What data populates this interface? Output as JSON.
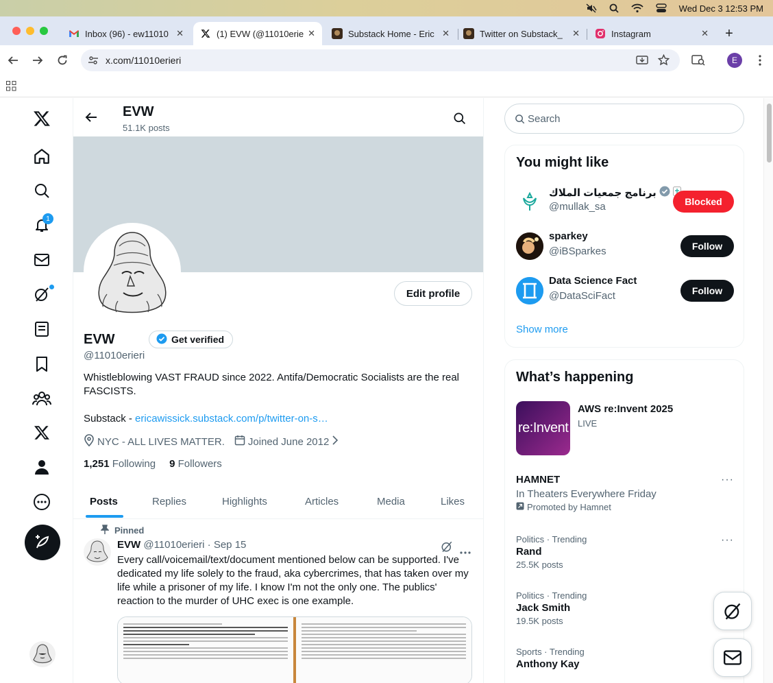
{
  "menubar": {
    "datetime": "Wed Dec 3  12:53 PM"
  },
  "tabs": [
    {
      "label": "Inbox (96) - ew11010",
      "icon": "gmail-icon"
    },
    {
      "label": "(1) EVW (@11010erieri",
      "icon": "x-logo-icon"
    },
    {
      "label": "Substack Home - Eric",
      "icon": "substack-avatar-icon"
    },
    {
      "label": "Twitter on Substack_",
      "icon": "substack-avatar-icon"
    },
    {
      "label": "Instagram",
      "icon": "instagram-icon"
    }
  ],
  "toolbar": {
    "url": "x.com/11010erieri",
    "profile_initial": "E"
  },
  "header": {
    "name": "EVW",
    "posts_count": "51.1K posts"
  },
  "profile": {
    "name": "EVW",
    "get_verified": "Get verified",
    "edit_profile": "Edit profile",
    "handle": "@11010erieri",
    "bio": "Whistleblowing VAST FRAUD since 2022. Antifa/Democratic Socialists are the real FASCISTS.",
    "substack_prefix": "Substack - ",
    "substack_link": "ericawissick.substack.com/p/twitter-on-s…",
    "location": "NYC - ALL LIVES MATTER.",
    "joined": "Joined June 2012",
    "following_count": "1,251",
    "following_label": "Following",
    "followers_count": "9",
    "followers_label": "Followers"
  },
  "profile_tabs": [
    "Posts",
    "Replies",
    "Highlights",
    "Articles",
    "Media",
    "Likes"
  ],
  "pinned_tweet": {
    "pinned_label": "Pinned",
    "author": "EVW",
    "handle_date": "@11010erieri · Sep 15",
    "text": "Every call/voicemail/text/document mentioned below can be supported. I've dedicated my life solely to the fraud, aka cybercrimes, that has taken over my life while a prisoner of my life. I know I'm not the only one. The publics' reaction to the murder of UHC exec is one example."
  },
  "search": {
    "placeholder": "Search"
  },
  "you_might_like": {
    "title": "You might like",
    "accounts": [
      {
        "name": "برنامج جمعيات الملاك",
        "handle": "@mullak_sa",
        "button": "Blocked",
        "button_color": "#f4212e"
      },
      {
        "name": "sparkey",
        "handle": "@iBSparkes",
        "button": "Follow",
        "button_color": "#0f1419"
      },
      {
        "name": "Data Science Fact",
        "handle": "@DataSciFact",
        "button": "Follow",
        "button_color": "#0f1419"
      }
    ],
    "show_more": "Show more"
  },
  "whats_happening": {
    "title": "What’s happening",
    "event": {
      "title": "AWS re:Invent 2025",
      "status": "LIVE",
      "thumb_text": "re:Invent"
    },
    "promoted": {
      "title": "HAMNET",
      "subtitle": "In Theaters Everywhere Friday",
      "promoted_by": "Promoted by Hamnet"
    },
    "trends": [
      {
        "context": "Politics · Trending",
        "title": "Rand",
        "count": "25.5K posts"
      },
      {
        "context": "Politics · Trending",
        "title": "Jack Smith",
        "count": "19.5K posts"
      },
      {
        "context": "Sports · Trending",
        "title": "Anthony Kay",
        "count": ""
      }
    ]
  },
  "notifications_badge": "1",
  "colors": {
    "accent": "#1d9bf0",
    "blocked": "#f4212e",
    "text": "#0f1419",
    "muted": "#536471"
  }
}
